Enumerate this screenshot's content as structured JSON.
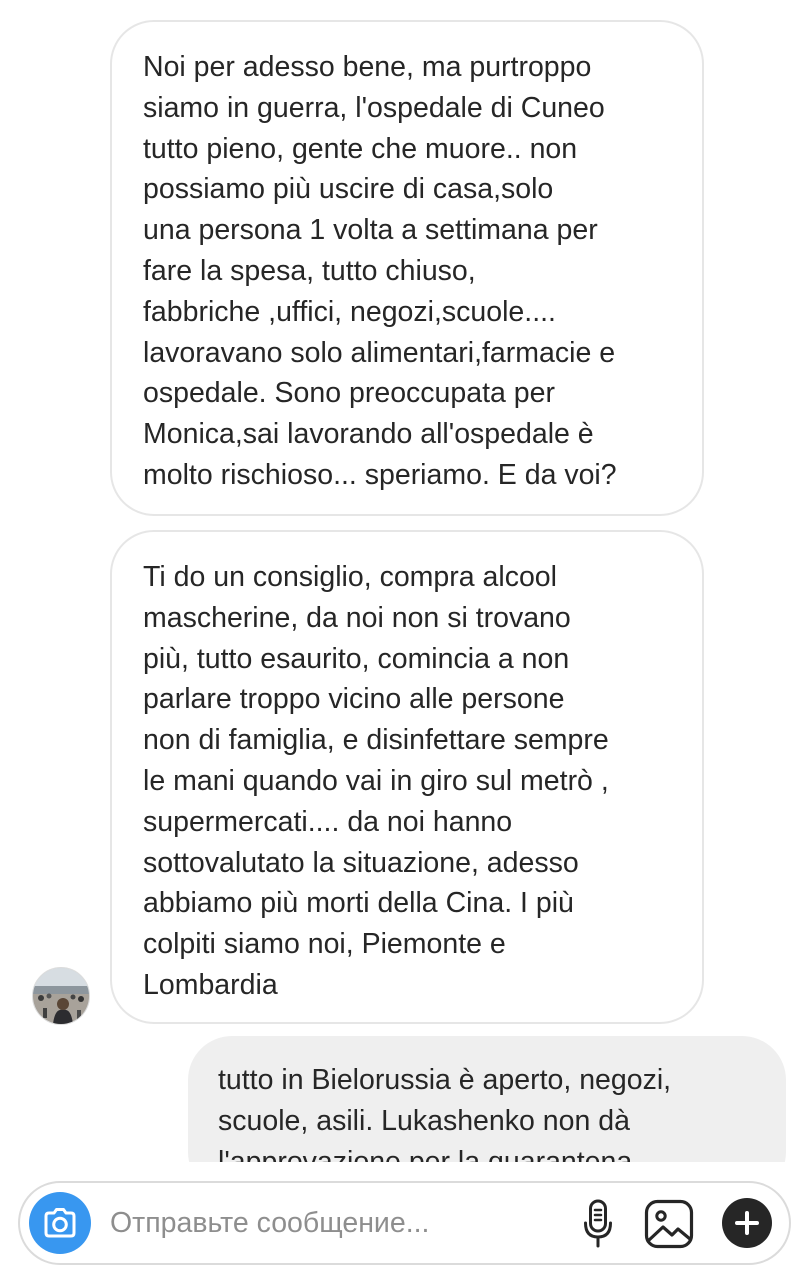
{
  "thread": {
    "messages": [
      {
        "sender": "incoming",
        "text": "Noi per adesso bene, ma purtroppo\nsiamo in guerra, l'ospedale di Cuneo\ntutto pieno, gente che muore.. non\npossiamo più  uscire  di casa,solo\nuna persona 1 volta a settimana per\nfare la spesa, tutto chiuso,\nfabbriche ,uffici, negozi,scuole....\nlavoravano solo alimentari,farmacie e\nospedale. Sono preoccupata  per\nMonica,sai lavorando all'ospedale è\nmolto rischioso... speriamo. E da voi?"
      },
      {
        "sender": "incoming",
        "text": "Ti do un consiglio, compra alcool\nmascherine, da noi non si trovano\npiù,  tutto esaurito, comincia a non\nparlare troppo vicino alle persone\nnon di famiglia, e disinfettare sempre\nle mani quando vai in giro sul metrò ,\nsupermercati.... da noi hanno\nsottovalutato la situazione, adesso\nabbiamo più  morti della Cina. I più\ncolpiti siamo noi, Piemonte e\nLombardia"
      },
      {
        "sender": "outgoing",
        "text": "tutto in Bielorussia è aperto, negozi,\nscuole, asili. Lukashenko non dà\nl'approvazione per la quarantena"
      }
    ]
  },
  "composer": {
    "placeholder": "Отправьте сообщение...",
    "camera_icon": "camera-icon",
    "mic_icon": "microphone-icon",
    "gallery_icon": "gallery-icon",
    "add_icon": "plus-icon"
  },
  "colors": {
    "accent": "#3897f0",
    "incoming_border": "#e6e6e6",
    "outgoing_bg": "#efefef",
    "text": "#262626",
    "placeholder": "#8e8e8e"
  }
}
